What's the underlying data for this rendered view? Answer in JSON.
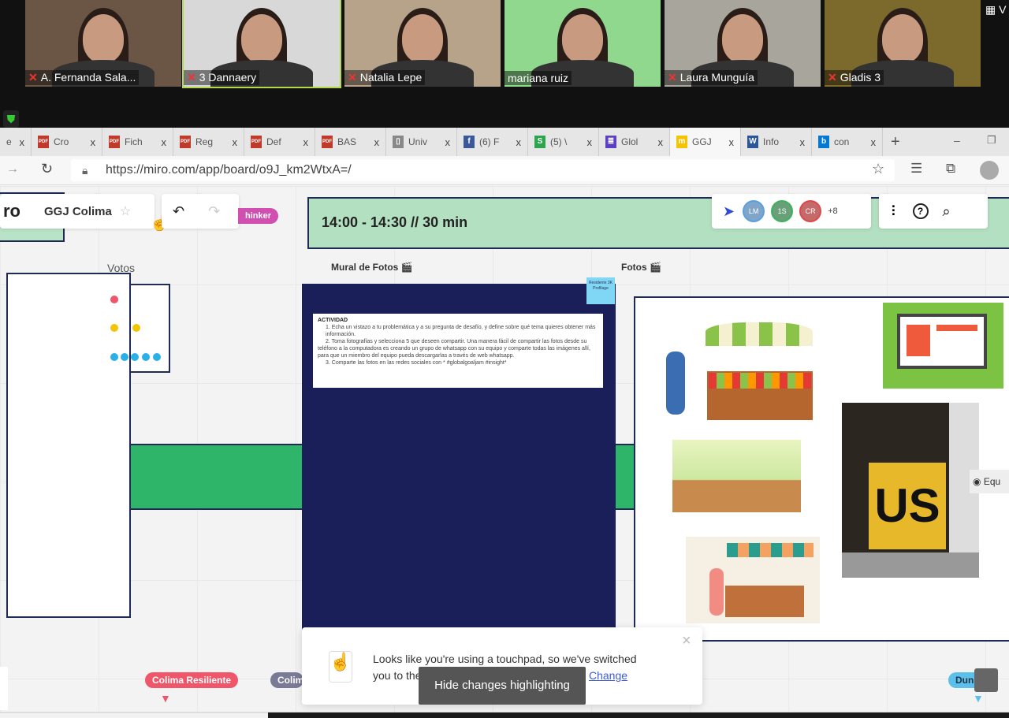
{
  "meeting": {
    "participants": [
      {
        "name": "A. Fernanda Sala...",
        "muted": true,
        "bg": "#6b5646"
      },
      {
        "name": "3 Dannaery",
        "muted": true,
        "bg": "#d8d8d8"
      },
      {
        "name": "Natalia Lepe",
        "muted": true,
        "bg": "#b7a38a"
      },
      {
        "name": "mariana ruiz",
        "muted": false,
        "bg": "#8fd88d"
      },
      {
        "name": "Laura Munguía",
        "muted": true,
        "bg": "#a7a59c"
      },
      {
        "name": "Gladis 3",
        "muted": true,
        "bg": "#7c6a2c"
      }
    ],
    "mic_off": "🎤̸",
    "view_label": "V"
  },
  "browser": {
    "tabs": [
      {
        "label": "e",
        "icon": "",
        "color": ""
      },
      {
        "label": "Cro",
        "icon": "PDF",
        "color": "#c0392b"
      },
      {
        "label": "Fich",
        "icon": "PDF",
        "color": "#c0392b"
      },
      {
        "label": "Reg",
        "icon": "PDF",
        "color": "#c0392b"
      },
      {
        "label": "Def",
        "icon": "PDF",
        "color": "#c0392b"
      },
      {
        "label": "BAS",
        "icon": "PDF",
        "color": "#c0392b"
      },
      {
        "label": "Univ",
        "icon": "▯",
        "color": "#888"
      },
      {
        "label": "(6) F",
        "icon": "f",
        "color": "#3b5998"
      },
      {
        "label": "(5) \\",
        "icon": "S",
        "color": "#2ea44f"
      },
      {
        "label": "Glol",
        "icon": "≣",
        "color": "#5b3fc4"
      },
      {
        "label": "GGJ",
        "icon": "m",
        "color": "#f5c400",
        "active": true
      },
      {
        "label": "Info",
        "icon": "W",
        "color": "#2b579a"
      },
      {
        "label": "con",
        "icon": "b",
        "color": "#0078d4"
      }
    ],
    "new_tab": "+",
    "close": "x",
    "url": "https://miro.com/app/board/o9J_km2WtxA=/"
  },
  "miro": {
    "logo": "ro",
    "board_name": "GGJ Colima",
    "tag_label": "hinker",
    "timer_text": "14:00 - 14:30  // 30 min",
    "avatars": [
      {
        "initials": "LM",
        "color": "#7fa6c9",
        "border": "#5aa0e0"
      },
      {
        "initials": "1S",
        "color": "#6aa079",
        "border": "#3fb15a"
      },
      {
        "initials": "CR",
        "color": "#c46a6a",
        "border": "#e04848"
      }
    ],
    "more_users": "+8",
    "frames": {
      "votos": "Votos",
      "mural": "Mural de Fotos 🎬",
      "fotos": "Fotos 🎬"
    },
    "sticky": "Residente 3K Profilage",
    "activity": {
      "title": "ACTIVIDAD",
      "items": [
        "1. Echa un vistazo a tu  problemática y a su pregunta de desafío, y define sobre qué tema quieres obtener más información.",
        "2. Toma fotografías y selecciona 5 que deseen compartir. Una manera fácil de compartir las fotos desde su teléfono a la computadora es creando un grupo de whatsapp con su equipo y comparte todas las imágenes allí, para que un miembro del equipo pueda descargarlas a través de web whatsapp.",
        "3. Comparte las fotos en las redes sociales con * #globalgoaljam #insight*"
      ]
    },
    "side_label": "Equ",
    "cursors": [
      {
        "name": "Colima Resiliente",
        "color": "#f0566a"
      },
      {
        "name": "Colim",
        "color": "#7a7a96"
      },
      {
        "name": "Dunia",
        "color": "#5bc0eb"
      }
    ],
    "toast": {
      "text": "Looks like you're using a touchpad, so we've switched you to the appropriate navigation mode.",
      "link": "Change",
      "close": "×"
    },
    "tooltip": "Hide changes highlighting"
  }
}
